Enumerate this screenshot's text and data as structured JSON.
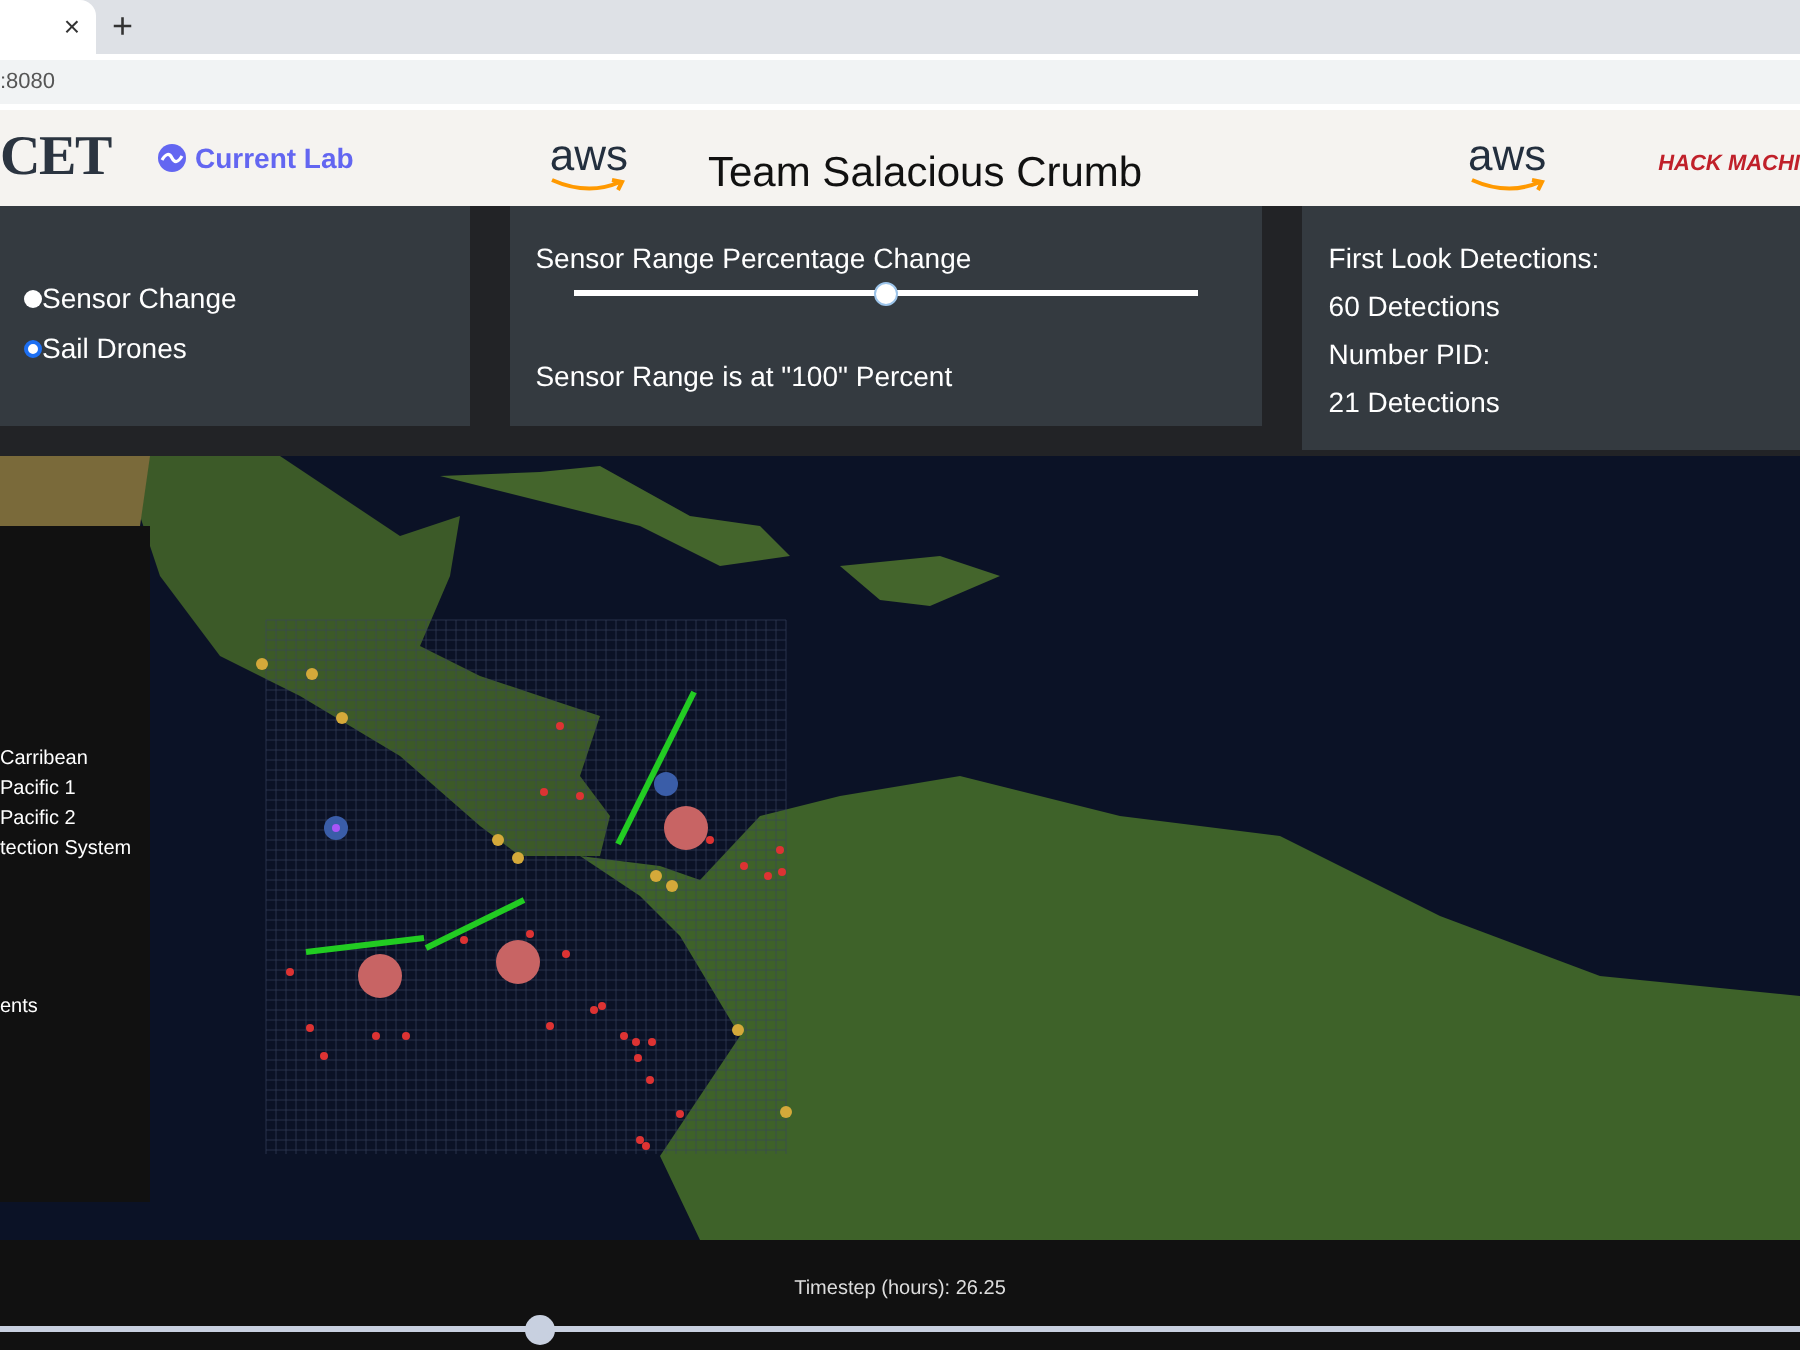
{
  "browser": {
    "tab_close": "×",
    "new_tab": "+",
    "address": ":8080"
  },
  "header": {
    "left_logos": [
      {
        "kind": "serif",
        "text": "CET"
      },
      {
        "kind": "wave",
        "text": "Current Lab"
      },
      {
        "kind": "aws",
        "text": "aws"
      }
    ],
    "title": "Team Salacious Crumb",
    "right_logos": [
      {
        "kind": "aws",
        "text": "aws"
      },
      {
        "kind": "hack",
        "text": "HACK",
        "text2": "MACHI"
      }
    ]
  },
  "mode_panel": {
    "options": [
      {
        "label": "Sensor Change",
        "selected": false
      },
      {
        "label": "Sail Drones",
        "selected": true
      }
    ]
  },
  "range_panel": {
    "title": "Sensor Range Percentage Change",
    "level": 0.5,
    "reading": "Sensor Range is at \"100\" Percent"
  },
  "detections_panel": {
    "lines": [
      "First Look Detections:",
      "60 Detections",
      "Number PID:",
      "21 Detections"
    ]
  },
  "legend": {
    "groups": [
      [
        "Carribean",
        "Pacific 1",
        "Pacific 2",
        "tection System"
      ],
      [
        "ents"
      ]
    ]
  },
  "timestep": {
    "label": "Timestep (hours): 26.25",
    "level": 0.3
  }
}
